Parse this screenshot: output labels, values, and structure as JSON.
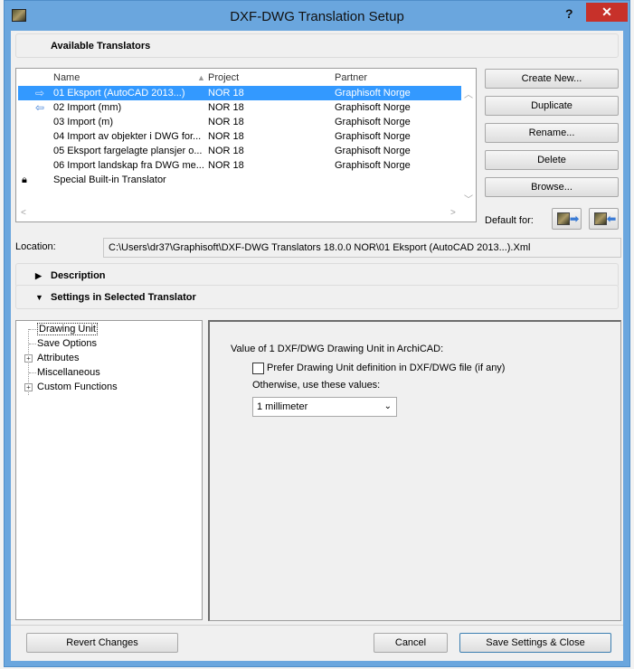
{
  "window": {
    "title": "DXF-DWG Translation Setup",
    "help": "?",
    "close": "✕"
  },
  "sections": {
    "available": "Available Translators",
    "description": "Description",
    "settings": "Settings in Selected Translator"
  },
  "table": {
    "headers": {
      "name": "Name",
      "project": "Project",
      "partner": "Partner"
    },
    "rows": [
      {
        "name": "01 Eksport (AutoCAD 2013...)",
        "project": "NOR 18",
        "partner": "Graphisoft Norge",
        "icon": "export-arrow-icon"
      },
      {
        "name": "02 Import (mm)",
        "project": "NOR 18",
        "partner": "Graphisoft Norge",
        "icon": "import-arrow-icon"
      },
      {
        "name": "03 Import (m)",
        "project": "NOR 18",
        "partner": "Graphisoft Norge",
        "icon": ""
      },
      {
        "name": "04 Import av objekter i DWG for...",
        "project": "NOR 18",
        "partner": "Graphisoft Norge",
        "icon": ""
      },
      {
        "name": "05 Eksport fargelagte plansjer o...",
        "project": "NOR 18",
        "partner": "Graphisoft Norge",
        "icon": ""
      },
      {
        "name": "06 Import landskap fra DWG me...",
        "project": "NOR 18",
        "partner": "Graphisoft Norge",
        "icon": ""
      },
      {
        "name": "Special Built-in Translator",
        "project": "",
        "partner": "",
        "icon": "lock-icon"
      }
    ]
  },
  "buttons": {
    "create_new": "Create New...",
    "duplicate": "Duplicate",
    "rename": "Rename...",
    "delete": "Delete",
    "browse": "Browse...",
    "default_for": "Default for:",
    "revert": "Revert Changes",
    "cancel": "Cancel",
    "save_close": "Save Settings & Close"
  },
  "location": {
    "label": "Location:",
    "value": "C:\\Users\\dr37\\Graphisoft\\DXF-DWG Translators 18.0.0 NOR\\01 Eksport (AutoCAD 2013...).Xml"
  },
  "tree": {
    "items": [
      {
        "label": "Drawing Unit",
        "expandable": false,
        "selected": true
      },
      {
        "label": "Save Options",
        "expandable": false
      },
      {
        "label": "Attributes",
        "expandable": true
      },
      {
        "label": "Miscellaneous",
        "expandable": false
      },
      {
        "label": "Custom Functions",
        "expandable": true
      }
    ]
  },
  "settings": {
    "heading": "Value of 1 DXF/DWG Drawing Unit in ArchiCAD:",
    "checkbox_label": "Prefer Drawing Unit definition in DXF/DWG file (if any)",
    "checkbox_checked": false,
    "otherwise": "Otherwise, use these values:",
    "unit_value": "1 millimeter"
  },
  "colors": {
    "title_bar": "#6aa6de",
    "selection": "#3399ff",
    "close_button": "#c7312a"
  }
}
